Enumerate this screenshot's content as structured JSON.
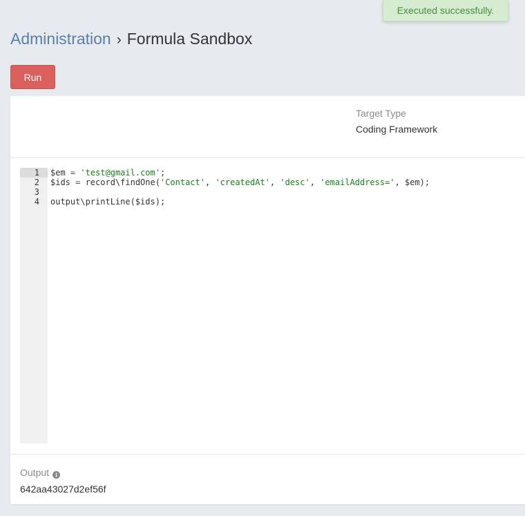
{
  "toast": {
    "message": "Executed successfully.",
    "color": "#d5ecd0"
  },
  "breadcrumb": {
    "parent": "Administration",
    "separator": "›",
    "current": "Formula Sandbox"
  },
  "toolbar": {
    "run_label": "Run",
    "run_color": "#d9605d"
  },
  "fields": {
    "target_type": {
      "label": "Target Type",
      "value": "Coding Framework"
    }
  },
  "editor": {
    "active_line": 1,
    "lines": [
      {
        "num": "1",
        "tokens": [
          {
            "t": "$em ",
            "c": ""
          },
          {
            "t": "=",
            "c": "op"
          },
          {
            "t": " ",
            "c": ""
          },
          {
            "t": "'test@gmail.com'",
            "c": "str"
          },
          {
            "t": ";",
            "c": ""
          }
        ]
      },
      {
        "num": "2",
        "tokens": [
          {
            "t": "$ids ",
            "c": ""
          },
          {
            "t": "=",
            "c": "op"
          },
          {
            "t": " record\\findOne(",
            "c": ""
          },
          {
            "t": "'Contact'",
            "c": "str"
          },
          {
            "t": ", ",
            "c": ""
          },
          {
            "t": "'createdAt'",
            "c": "str"
          },
          {
            "t": ", ",
            "c": ""
          },
          {
            "t": "'desc'",
            "c": "str"
          },
          {
            "t": ", ",
            "c": ""
          },
          {
            "t": "'emailAddress='",
            "c": "str"
          },
          {
            "t": ", $em);",
            "c": ""
          }
        ]
      },
      {
        "num": "3",
        "tokens": []
      },
      {
        "num": "4",
        "tokens": [
          {
            "t": "output\\printLine($ids);",
            "c": ""
          }
        ]
      }
    ]
  },
  "output": {
    "label": "Output",
    "info_icon": "info-circle-icon",
    "value": "642aa43027d2ef56f"
  }
}
